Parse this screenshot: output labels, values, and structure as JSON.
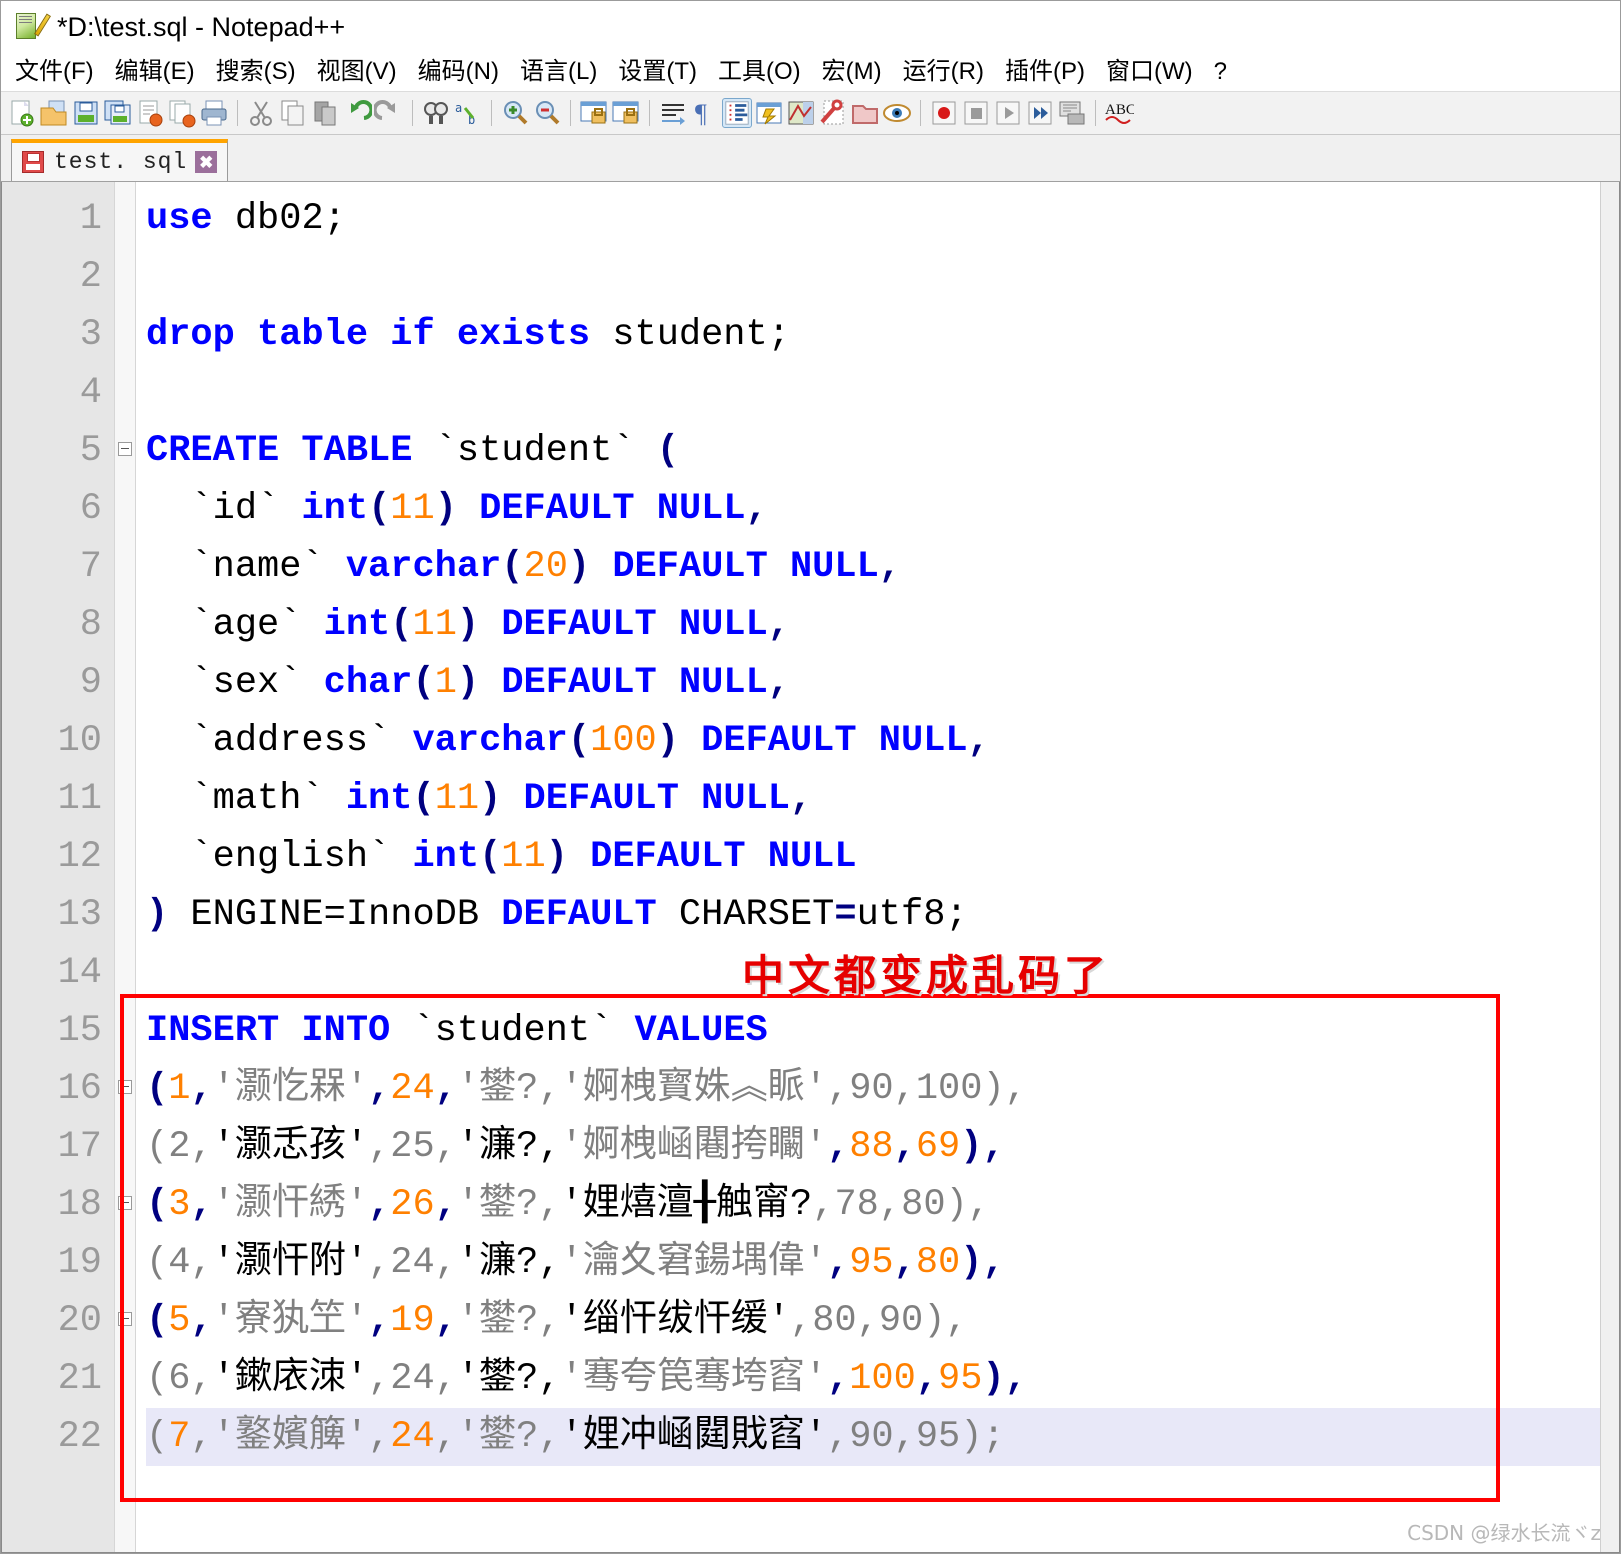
{
  "window": {
    "title": "*D:\\test.sql - Notepad++",
    "app_icon": "notepad-plus-plus-icon"
  },
  "menubar": {
    "items": [
      {
        "label": "文件(F)",
        "name": "menu-file"
      },
      {
        "label": "编辑(E)",
        "name": "menu-edit"
      },
      {
        "label": "搜索(S)",
        "name": "menu-search"
      },
      {
        "label": "视图(V)",
        "name": "menu-view"
      },
      {
        "label": "编码(N)",
        "name": "menu-encoding"
      },
      {
        "label": "语言(L)",
        "name": "menu-language"
      },
      {
        "label": "设置(T)",
        "name": "menu-settings"
      },
      {
        "label": "工具(O)",
        "name": "menu-tools"
      },
      {
        "label": "宏(M)",
        "name": "menu-macro"
      },
      {
        "label": "运行(R)",
        "name": "menu-run"
      },
      {
        "label": "插件(P)",
        "name": "menu-plugins"
      },
      {
        "label": "窗口(W)",
        "name": "menu-window"
      },
      {
        "label": "?",
        "name": "menu-help"
      }
    ]
  },
  "toolbar": {
    "buttons": [
      "new-file-icon",
      "open-file-icon",
      "save-icon",
      "save-all-icon",
      "close-file-icon",
      "close-all-icon",
      "print-icon",
      "cut-icon",
      "copy-icon",
      "paste-icon",
      "undo-icon",
      "redo-icon",
      "find-icon",
      "replace-icon",
      "zoom-in-icon",
      "zoom-out-icon",
      "sync-scroll-vertical-icon",
      "sync-scroll-horizontal-icon",
      "word-wrap-icon",
      "show-all-characters-icon",
      "indent-guide-icon",
      "user-defined-language-icon",
      "doc-map-icon",
      "function-list-icon",
      "folder-as-workspace-icon",
      "monitoring-icon",
      "record-macro-icon",
      "stop-record-icon",
      "play-macro-icon",
      "run-macro-multiple-icon",
      "save-macro-icon",
      "spell-check-icon"
    ]
  },
  "tab": {
    "label": "test. sql",
    "icon": "red-save-icon",
    "close": "✖"
  },
  "annotation": {
    "red_note": "中文都变成乱码了"
  },
  "watermark": "CSDN @绿水长流ヾz",
  "editor": {
    "current_line": 22,
    "lines": [
      {
        "n": 1,
        "fold": false,
        "tokens": [
          [
            "kw",
            "use"
          ],
          [
            "plain",
            " db02;"
          ]
        ]
      },
      {
        "n": 2,
        "fold": false,
        "tokens": []
      },
      {
        "n": 3,
        "fold": false,
        "tokens": [
          [
            "kw",
            "drop table if exists"
          ],
          [
            "plain",
            " student;"
          ]
        ]
      },
      {
        "n": 4,
        "fold": false,
        "tokens": []
      },
      {
        "n": 5,
        "fold": true,
        "tokens": [
          [
            "kw",
            "CREATE TABLE"
          ],
          [
            "plain",
            " `student` "
          ],
          [
            "punc",
            "("
          ]
        ]
      },
      {
        "n": 6,
        "fold": false,
        "tokens": [
          [
            "plain",
            "  `id` "
          ],
          [
            "kw",
            "int"
          ],
          [
            "punc",
            "("
          ],
          [
            "num",
            "11"
          ],
          [
            "punc",
            ")"
          ],
          [
            "kw",
            " DEFAULT NULL"
          ],
          [
            "punc",
            ","
          ]
        ]
      },
      {
        "n": 7,
        "fold": false,
        "tokens": [
          [
            "plain",
            "  `name` "
          ],
          [
            "kw",
            "varchar"
          ],
          [
            "punc",
            "("
          ],
          [
            "num",
            "20"
          ],
          [
            "punc",
            ")"
          ],
          [
            "kw",
            " DEFAULT NULL"
          ],
          [
            "punc",
            ","
          ]
        ]
      },
      {
        "n": 8,
        "fold": false,
        "tokens": [
          [
            "plain",
            "  `age` "
          ],
          [
            "kw",
            "int"
          ],
          [
            "punc",
            "("
          ],
          [
            "num",
            "11"
          ],
          [
            "punc",
            ")"
          ],
          [
            "kw",
            " DEFAULT NULL"
          ],
          [
            "punc",
            ","
          ]
        ]
      },
      {
        "n": 9,
        "fold": false,
        "tokens": [
          [
            "plain",
            "  `sex` "
          ],
          [
            "kw",
            "char"
          ],
          [
            "punc",
            "("
          ],
          [
            "num",
            "1"
          ],
          [
            "punc",
            ")"
          ],
          [
            "kw",
            " DEFAULT NULL"
          ],
          [
            "punc",
            ","
          ]
        ]
      },
      {
        "n": 10,
        "fold": false,
        "tokens": [
          [
            "plain",
            "  `address` "
          ],
          [
            "kw",
            "varchar"
          ],
          [
            "punc",
            "("
          ],
          [
            "num",
            "100"
          ],
          [
            "punc",
            ")"
          ],
          [
            "kw",
            " DEFAULT NULL"
          ],
          [
            "punc",
            ","
          ]
        ]
      },
      {
        "n": 11,
        "fold": false,
        "tokens": [
          [
            "plain",
            "  `math` "
          ],
          [
            "kw",
            "int"
          ],
          [
            "punc",
            "("
          ],
          [
            "num",
            "11"
          ],
          [
            "punc",
            ")"
          ],
          [
            "kw",
            " DEFAULT NULL"
          ],
          [
            "punc",
            ","
          ]
        ]
      },
      {
        "n": 12,
        "fold": false,
        "tokens": [
          [
            "plain",
            "  `english` "
          ],
          [
            "kw",
            "int"
          ],
          [
            "punc",
            "("
          ],
          [
            "num",
            "11"
          ],
          [
            "punc",
            ")"
          ],
          [
            "kw",
            " DEFAULT NULL"
          ]
        ]
      },
      {
        "n": 13,
        "fold": false,
        "tokens": [
          [
            "punc",
            ")"
          ],
          [
            "plain",
            " ENGINE=InnoDB "
          ],
          [
            "kw",
            "DEFAULT"
          ],
          [
            "plain",
            " CHARSET"
          ],
          [
            "punc",
            "="
          ],
          [
            "plain",
            "utf8;"
          ]
        ]
      },
      {
        "n": 14,
        "fold": false,
        "tokens": []
      },
      {
        "n": 15,
        "fold": false,
        "tokens": [
          [
            "kw",
            "INSERT INTO"
          ],
          [
            "plain",
            " `student` "
          ],
          [
            "kw",
            "VALUES"
          ]
        ]
      },
      {
        "n": 16,
        "fold": true,
        "tokens": [
          [
            "punc",
            "("
          ],
          [
            "num",
            "1"
          ],
          [
            "punc",
            ","
          ],
          [
            "str",
            "'灏忔槑'"
          ],
          [
            "punc",
            ","
          ],
          [
            "num",
            "24"
          ],
          [
            "punc",
            ","
          ],
          [
            "str",
            "'鐢?,"
          ],
          [
            "str",
            "'婀栧寳姝︽眽'"
          ],
          [
            "dim",
            ","
          ],
          [
            "dimn",
            "90"
          ],
          [
            "dim",
            ","
          ],
          [
            "dimn",
            "100"
          ],
          [
            "dim",
            ")"
          ],
          [
            "dim",
            ","
          ]
        ]
      },
      {
        "n": 17,
        "fold": false,
        "tokens": [
          [
            "dim",
            "("
          ],
          [
            "dimn",
            "2"
          ],
          [
            "dim",
            ","
          ],
          [
            "plain",
            "'灏忎孩'"
          ],
          [
            "dim",
            ","
          ],
          [
            "dimn",
            "25"
          ],
          [
            "dim",
            ","
          ],
          [
            "plain",
            "'濂?,"
          ],
          [
            "str",
            "'婀栧崡闀挎矙'"
          ],
          [
            "punc",
            ","
          ],
          [
            "num",
            "88"
          ],
          [
            "punc",
            ","
          ],
          [
            "num",
            "69"
          ],
          [
            "punc",
            ")"
          ],
          [
            "punc",
            ","
          ]
        ]
      },
      {
        "n": 18,
        "fold": true,
        "tokens": [
          [
            "punc",
            "("
          ],
          [
            "num",
            "3"
          ],
          [
            "punc",
            ","
          ],
          [
            "str",
            "'灏忓綉'"
          ],
          [
            "punc",
            ","
          ],
          [
            "num",
            "26"
          ],
          [
            "punc",
            ","
          ],
          [
            "str",
            "'鐢?,"
          ],
          [
            "plain",
            "'娌熺澶╂触甯?"
          ],
          [
            "dim",
            ","
          ],
          [
            "dimn",
            "78"
          ],
          [
            "dim",
            ","
          ],
          [
            "dimn",
            "80"
          ],
          [
            "dim",
            ")"
          ],
          [
            "dim",
            ","
          ]
        ]
      },
      {
        "n": 19,
        "fold": false,
        "tokens": [
          [
            "dim",
            "("
          ],
          [
            "dimn",
            "4"
          ],
          [
            "dim",
            ","
          ],
          [
            "plain",
            "'灏忓附'"
          ],
          [
            "dim",
            ","
          ],
          [
            "dimn",
            "24"
          ],
          [
            "dim",
            ","
          ],
          [
            "plain",
            "'濂?,"
          ],
          [
            "str",
            "'瀹夊窘鍚堣偉'"
          ],
          [
            "punc",
            ","
          ],
          [
            "num",
            "95"
          ],
          [
            "punc",
            ","
          ],
          [
            "num",
            "80"
          ],
          [
            "punc",
            ")"
          ],
          [
            "punc",
            ","
          ]
        ]
      },
      {
        "n": 20,
        "fold": true,
        "tokens": [
          [
            "punc",
            "("
          ],
          [
            "num",
            "5"
          ],
          [
            "punc",
            ","
          ],
          [
            "str",
            "'寮犱笁'"
          ],
          [
            "punc",
            ","
          ],
          [
            "num",
            "19"
          ],
          [
            "punc",
            ","
          ],
          [
            "str",
            "'鐢?,"
          ],
          [
            "plain",
            "'缁忓绂忓缓'"
          ],
          [
            "dim",
            ","
          ],
          [
            "dimn",
            "80"
          ],
          [
            "dim",
            ","
          ],
          [
            "dimn",
            "90"
          ],
          [
            "dim",
            ")"
          ],
          [
            "dim",
            ","
          ]
        ]
      },
      {
        "n": 21,
        "fold": false,
        "tokens": [
          [
            "dim",
            "("
          ],
          [
            "dimn",
            "6"
          ],
          [
            "dim",
            ","
          ],
          [
            "plain",
            "'鏉庡洓'"
          ],
          [
            "dim",
            ","
          ],
          [
            "dimn",
            "24"
          ],
          [
            "dim",
            ","
          ],
          [
            "plain",
            "'鐢?,"
          ],
          [
            "str",
            "'骞夸笢骞垮窞'"
          ],
          [
            "punc",
            ","
          ],
          [
            "num",
            "100"
          ],
          [
            "punc",
            ","
          ],
          [
            "num",
            "95"
          ],
          [
            "punc",
            ")"
          ],
          [
            "punc",
            ","
          ]
        ]
      },
      {
        "n": 22,
        "fold": false,
        "tokens": [
          [
            "dim",
            "("
          ],
          [
            "num",
            "7"
          ],
          [
            "dim",
            ","
          ],
          [
            "str",
            "'鐜嬪簲'"
          ],
          [
            "dim",
            ","
          ],
          [
            "num",
            "24"
          ],
          [
            "dim",
            ","
          ],
          [
            "str",
            "'鐢?,"
          ],
          [
            "plain",
            "'娌冲崡閮戝窞'"
          ],
          [
            "dim",
            ","
          ],
          [
            "dimn",
            "90"
          ],
          [
            "dim",
            ","
          ],
          [
            "dimn",
            "95"
          ],
          [
            "dim",
            ")"
          ],
          [
            "dim",
            ";"
          ]
        ]
      }
    ]
  }
}
